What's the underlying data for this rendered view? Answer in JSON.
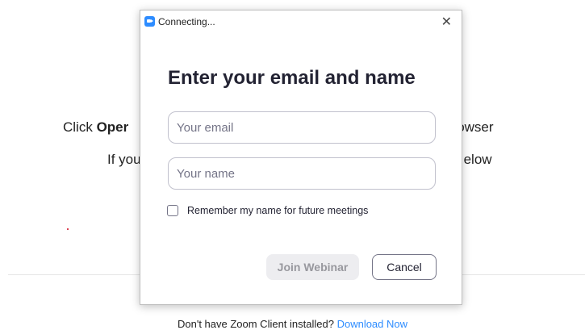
{
  "background": {
    "line1_prefix": "Click ",
    "line1_bold": "Oper",
    "line1_suffix": "ur browser",
    "line2_prefix": "If you",
    "line2_suffix": "elow",
    "footer_text": "Don't have Zoom Client installed? ",
    "footer_link": "Download Now"
  },
  "dialog": {
    "title": "Connecting...",
    "close_glyph": "✕",
    "heading": "Enter your email and name",
    "email_placeholder": "Your email",
    "name_placeholder": "Your name",
    "remember_label": "Remember my name for future meetings",
    "remember_checked": false,
    "join_label": "Join Webinar",
    "cancel_label": "Cancel"
  },
  "colors": {
    "accent": "#2d8cff",
    "disabled_button_bg": "#ededf0",
    "disabled_button_text": "#98989e"
  },
  "icons": {
    "app": "zoom-app-icon",
    "close": "close-icon"
  }
}
